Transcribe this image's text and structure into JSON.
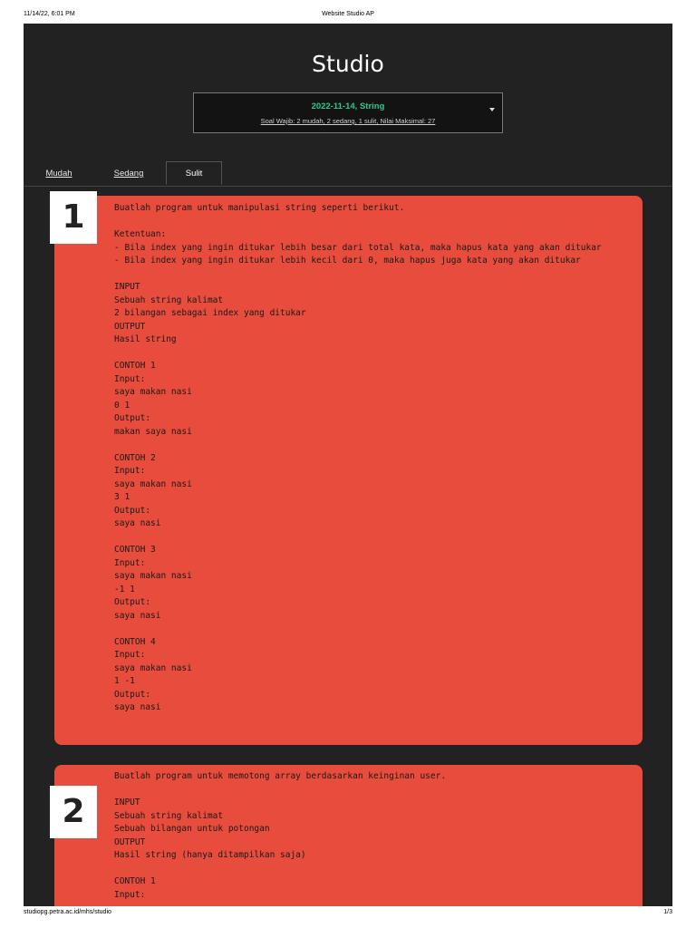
{
  "print": {
    "date": "11/14/22, 6:01 PM",
    "title": "Website Studio AP",
    "url": "studiopg.petra.ac.id/mhs/studio",
    "page": "1/3"
  },
  "app": {
    "title": "Studio",
    "session": {
      "title": "2022-11-14, String",
      "subtitle": "Soal Wajib: 2 mudah, 2 sedang, 1 sulit, Nilai Maksimal: 27"
    },
    "tabs": [
      {
        "label": "Mudah",
        "active": false
      },
      {
        "label": "Sedang",
        "active": false
      },
      {
        "label": "Sulit",
        "active": true
      }
    ]
  },
  "problems": [
    {
      "number": "1",
      "text": "Buatlah program untuk manipulasi string seperti berikut.\n\nKetentuan:\n- Bila index yang ingin ditukar lebih besar dari total kata, maka hapus kata yang akan ditukar\n- Bila index yang ingin ditukar lebih kecil dari 0, maka hapus juga kata yang akan ditukar\n\nINPUT\nSebuah string kalimat\n2 bilangan sebagai index yang ditukar\nOUTPUT\nHasil string\n\nCONTOH 1\nInput:\nsaya makan nasi\n0 1\nOutput:\nmakan saya nasi\n\nCONTOH 2\nInput:\nsaya makan nasi\n3 1\nOutput:\nsaya nasi\n\nCONTOH 3\nInput:\nsaya makan nasi\n-1 1\nOutput:\nsaya nasi\n\nCONTOH 4\nInput:\nsaya makan nasi\n1 -1\nOutput:\nsaya nasi"
    },
    {
      "number": "2",
      "text": "Buatlah program untuk memotong array berdasarkan keinginan user.\n\nINPUT\nSebuah string kalimat\nSebuah bilangan untuk potongan\nOUTPUT\nHasil string (hanya ditampilkan saja)\n\nCONTOH 1\nInput:"
    }
  ],
  "colors": {
    "background": "#222222",
    "card": "#e74c3c",
    "accent": "#2bc98a"
  }
}
